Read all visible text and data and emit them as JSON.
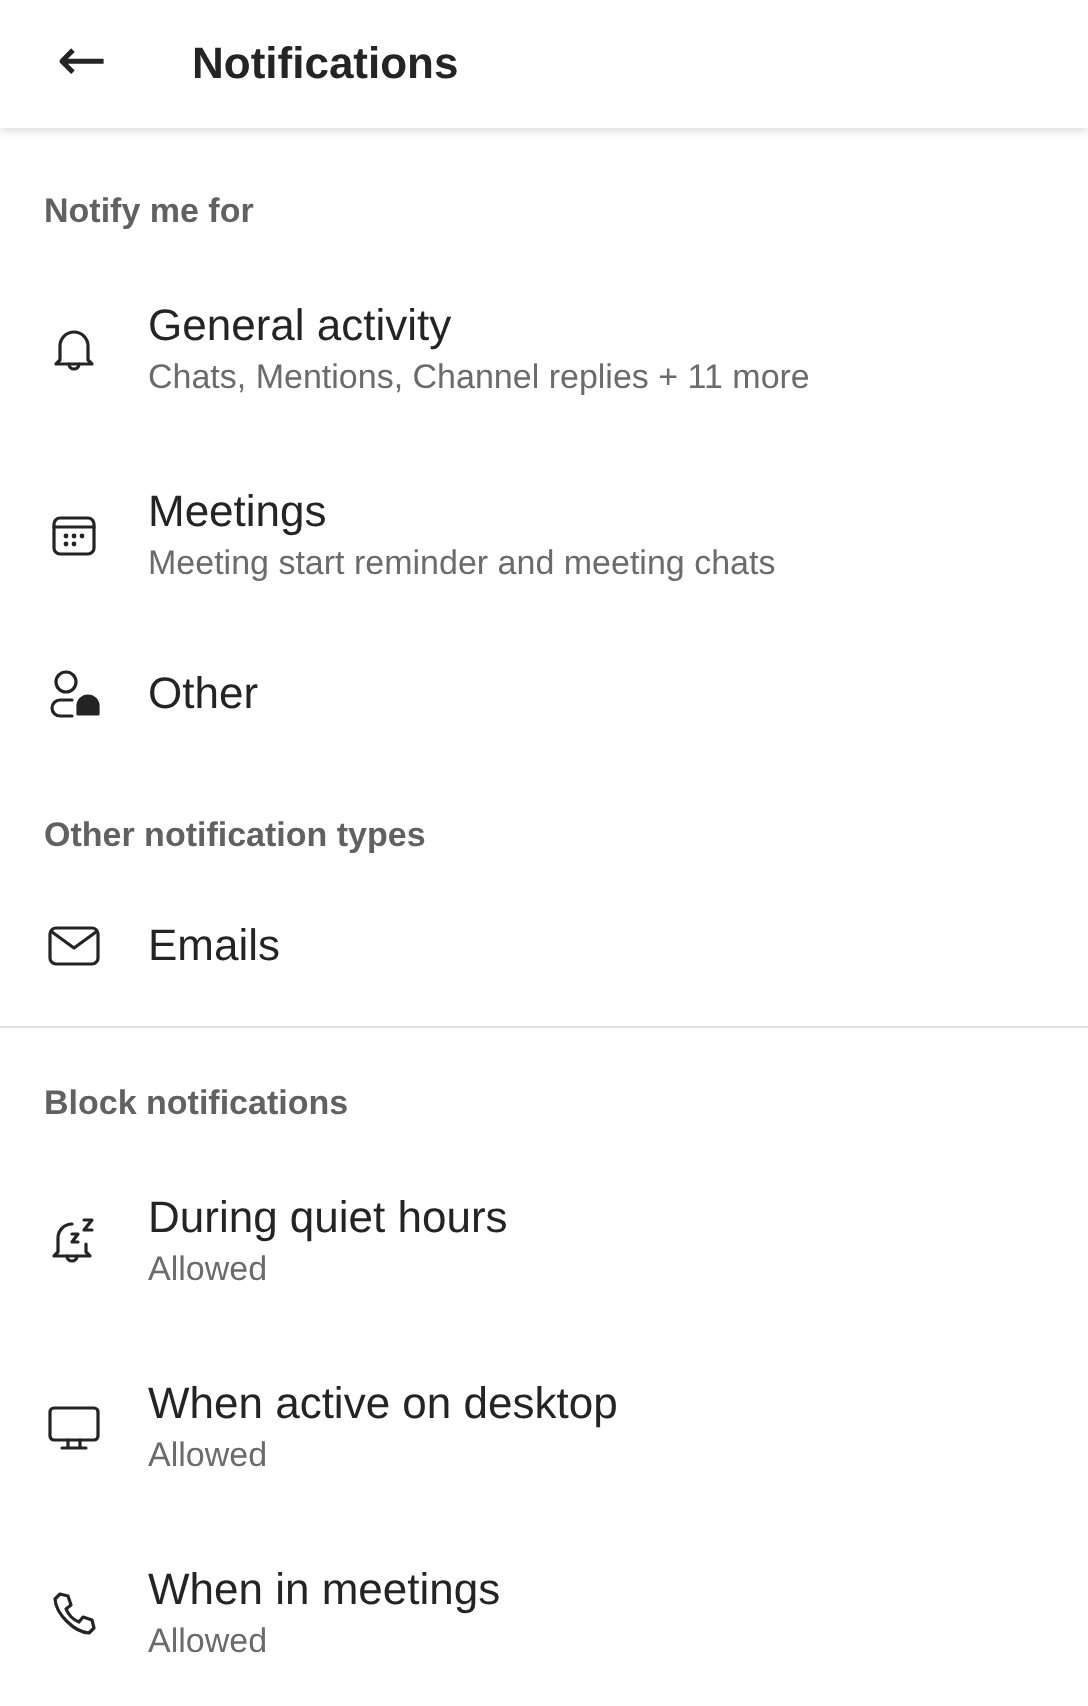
{
  "header": {
    "back": "←",
    "title": "Notifications"
  },
  "sections": [
    {
      "label": "Notify me for",
      "divider_before": false,
      "items": [
        {
          "kind": "bell",
          "title": "General activity",
          "subtitle": "Chats, Mentions, Channel replies + 11 more"
        },
        {
          "kind": "calendar",
          "title": "Meetings",
          "subtitle": "Meeting start reminder and meeting chats"
        },
        {
          "kind": "person-bell",
          "title": "Other"
        }
      ]
    },
    {
      "label": "Other notification types",
      "divider_before": false,
      "items": [
        {
          "kind": "mail",
          "title": "Emails"
        }
      ]
    },
    {
      "label": "Block notifications",
      "divider_before": true,
      "items": [
        {
          "kind": "snooze",
          "title": "During quiet hours",
          "subtitle": "Allowed"
        },
        {
          "kind": "monitor",
          "title": "When active on desktop",
          "subtitle": "Allowed"
        },
        {
          "kind": "phone",
          "title": "When in meetings",
          "subtitle": "Allowed"
        }
      ]
    }
  ]
}
